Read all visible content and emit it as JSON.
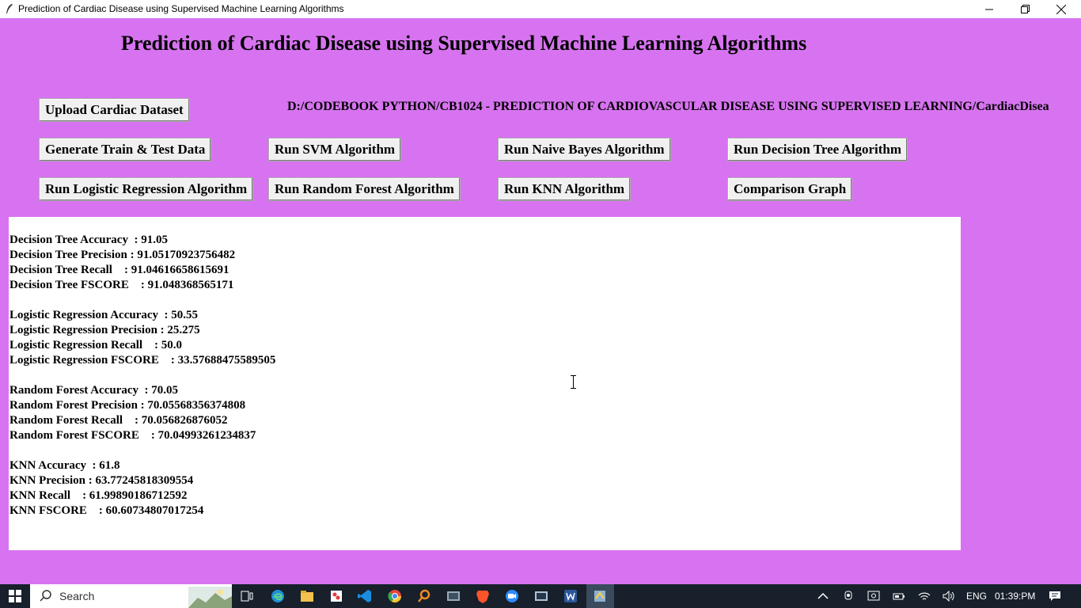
{
  "window": {
    "title": "Prediction of Cardiac Disease using Supervised Machine Learning Algorithms",
    "icons": [
      "feather-icon",
      "minimize-icon",
      "maximize-icon",
      "close-icon"
    ]
  },
  "heading": "Prediction of Cardiac Disease using Supervised Machine Learning Algorithms",
  "buttons": {
    "upload": "Upload Cardiac Dataset",
    "generate": "Generate Train & Test Data",
    "svm": "Run SVM Algorithm",
    "naive_bayes": "Run Naive Bayes Algorithm",
    "decision_tree": "Run Decision Tree Algorithm",
    "logistic": "Run Logistic Regression Algorithm",
    "random_forest": "Run Random Forest Algorithm",
    "knn": "Run KNN Algorithm",
    "comparison": "Comparison Graph"
  },
  "dataset_path": "D:/CODEBOOK PYTHON/CB1024 - PREDICTION OF CARDIOVASCULAR DISEASE USING SUPERVISED LEARNING/CardiacDisea",
  "output": {
    "blocks": [
      [
        "Decision Tree Accuracy  : 91.05",
        "Decision Tree Precision : 91.05170923756482",
        "Decision Tree Recall    : 91.04616658615691",
        "Decision Tree FSCORE    : 91.048368565171"
      ],
      [
        "Logistic Regression Accuracy  : 50.55",
        "Logistic Regression Precision : 25.275",
        "Logistic Regression Recall    : 50.0",
        "Logistic Regression FSCORE    : 33.57688475589505"
      ],
      [
        "Random Forest Accuracy  : 70.05",
        "Random Forest Precision : 70.05568356374808",
        "Random Forest Recall    : 70.056826876052",
        "Random Forest FSCORE    : 70.04993261234837"
      ],
      [
        "KNN Accuracy  : 61.8",
        "KNN Precision : 63.77245818309554",
        "KNN Recall    : 61.99890186712592",
        "KNN FSCORE    : 60.60734807017254"
      ]
    ]
  },
  "taskbar": {
    "search_placeholder": "Search",
    "apps": [
      "task-view-icon",
      "edge-icon",
      "file-explorer-icon",
      "app-icon",
      "vscode-icon",
      "chrome-icon",
      "search-app-icon",
      "app-icon",
      "brave-icon",
      "zoom-icon",
      "app-icon",
      "word-icon",
      "python-icon"
    ],
    "language": "ENG",
    "time": "01:39:PM"
  },
  "colors": {
    "background": "#d773f0",
    "button": "#f0f0f0",
    "taskbar": "#17202b"
  }
}
